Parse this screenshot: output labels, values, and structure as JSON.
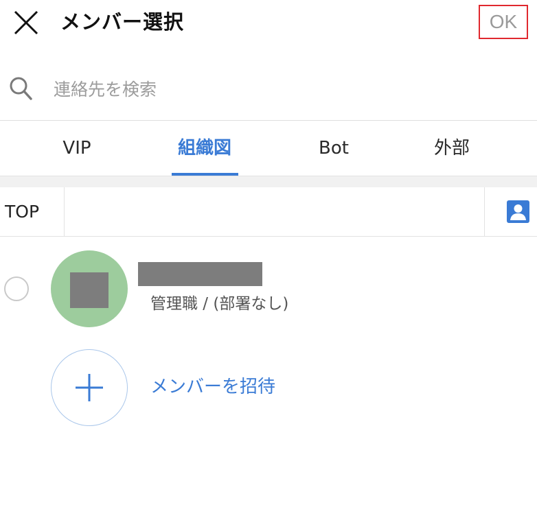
{
  "header": {
    "title": "メンバー選択",
    "ok_label": "OK"
  },
  "search": {
    "placeholder": "連絡先を検索"
  },
  "tabs": [
    {
      "label": "VIP"
    },
    {
      "label": "組織図",
      "active": true
    },
    {
      "label": "Bot"
    },
    {
      "label": "外部"
    }
  ],
  "breadcrumb": {
    "root_label": "TOP"
  },
  "member": {
    "subtitle": "管理職 / (部署なし)"
  },
  "invite": {
    "label": "メンバーを招待"
  },
  "colors": {
    "accent": "#3a7bd5",
    "ok_border": "#e0282e",
    "avatar_bg": "#9dcc9d"
  },
  "icons": [
    "close-icon",
    "search-icon",
    "contact-card-icon",
    "plus-icon"
  ]
}
